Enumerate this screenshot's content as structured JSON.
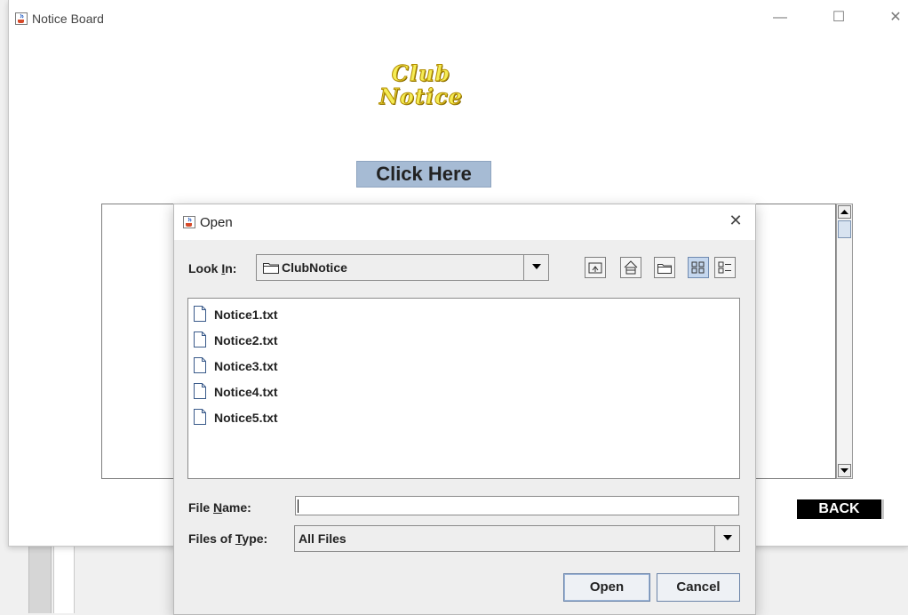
{
  "main_window": {
    "title": "Notice Board",
    "logo_line1": "Club",
    "logo_line2": "Notice",
    "click_here_label": "Click Here",
    "back_label": "BACK"
  },
  "dialog": {
    "title": "Open",
    "look_in": {
      "label_pre": "Look ",
      "label_mn": "I",
      "label_post": "n:",
      "value": "ClubNotice"
    },
    "files": [
      {
        "name": "Notice1.txt"
      },
      {
        "name": "Notice2.txt"
      },
      {
        "name": "Notice3.txt"
      },
      {
        "name": "Notice4.txt"
      },
      {
        "name": "Notice5.txt"
      }
    ],
    "file_name": {
      "label_pre": "File ",
      "label_mn": "N",
      "label_post": "ame:",
      "value": ""
    },
    "files_of_type": {
      "label_pre": "Files of ",
      "label_mn": "T",
      "label_post": "ype:",
      "value": "All Files"
    },
    "open_label": "Open",
    "cancel_label": "Cancel"
  },
  "icons": {
    "app": "java-cup-icon",
    "up": "up-folder-icon",
    "home": "home-icon",
    "new_folder": "new-folder-icon",
    "list": "list-view-icon",
    "details": "details-view-icon",
    "file": "file-icon"
  },
  "colors": {
    "click_here_bg": "#a6bbd4",
    "logo_fill": "#f5ec55",
    "back_bg": "#000000",
    "selected_tool": "#c5d7ee"
  }
}
